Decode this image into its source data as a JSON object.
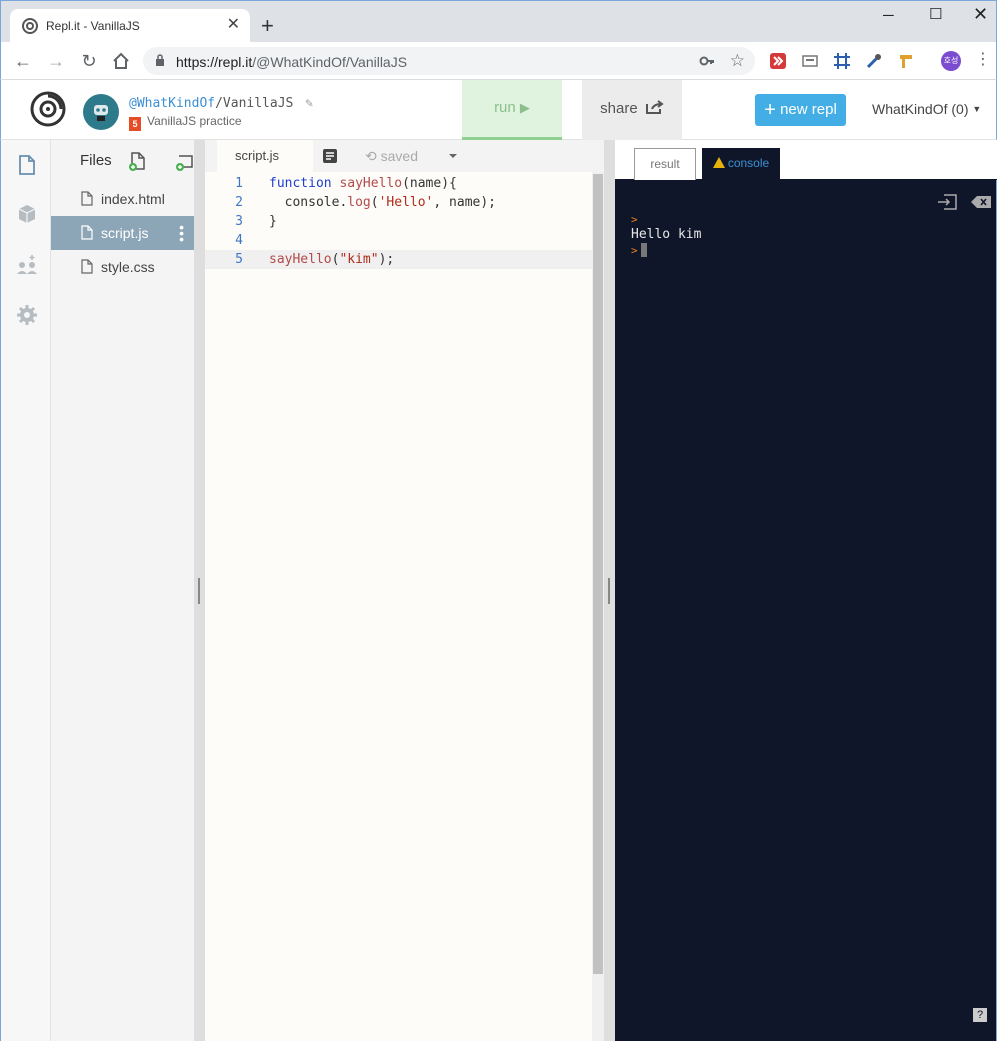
{
  "browser": {
    "tab_title": "Repl.it - VanillaJS",
    "url_scheme_host": "https://repl.it",
    "url_path": "/@WhatKindOf/VanillaJS",
    "profile_initials": "호성"
  },
  "repl": {
    "owner": "@WhatKindOf",
    "separator": "/",
    "name": "VanillaJS",
    "description": "VanillaJS practice",
    "run_label": "run",
    "share_label": "share",
    "new_repl_label": "new repl",
    "user_label": "WhatKindOf (0)"
  },
  "files": {
    "header": "Files",
    "items": [
      "index.html",
      "script.js",
      "style.css"
    ],
    "active": "script.js"
  },
  "editor": {
    "tab": "script.js",
    "status": "saved",
    "lines": [
      {
        "num": "1",
        "tokens": [
          {
            "t": "function",
            "c": "kw"
          },
          {
            "t": " "
          },
          {
            "t": "sayHello",
            "c": "fn"
          },
          {
            "t": "(name){"
          }
        ]
      },
      {
        "num": "2",
        "tokens": [
          {
            "t": "  console."
          },
          {
            "t": "log",
            "c": "fn"
          },
          {
            "t": "("
          },
          {
            "t": "'Hello'",
            "c": "str"
          },
          {
            "t": ", name);"
          }
        ]
      },
      {
        "num": "3",
        "tokens": [
          {
            "t": "}"
          }
        ]
      },
      {
        "num": "4",
        "tokens": []
      },
      {
        "num": "5",
        "tokens": [
          {
            "t": "sayHello",
            "c": "fn"
          },
          {
            "t": "("
          },
          {
            "t": "\"kim\"",
            "c": "str"
          },
          {
            "t": ");"
          }
        ]
      }
    ],
    "active_line": 5
  },
  "console": {
    "tab_result": "result",
    "tab_console": "console",
    "output": "Hello kim",
    "prompt": ">",
    "help": "?"
  },
  "colors": {
    "accent": "#43aee6",
    "console_bg": "#0f1629",
    "run_bg": "#dff3df"
  }
}
